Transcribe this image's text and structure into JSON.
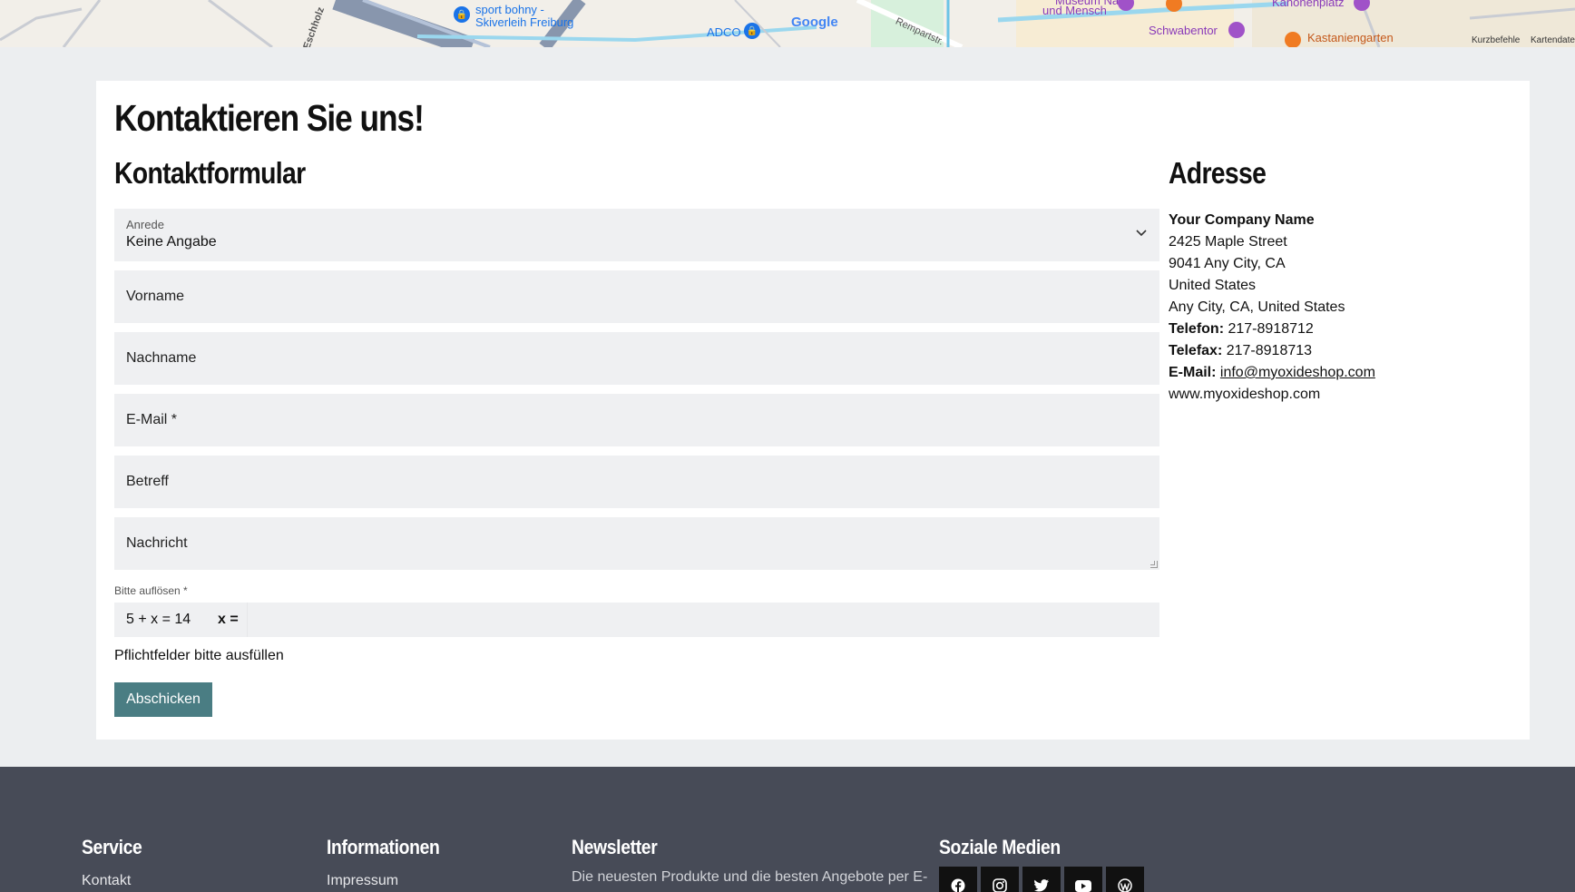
{
  "map": {
    "labels": {
      "sport": "sport bohny -",
      "skiverleih": "Skiverleih Freiburg",
      "adco": "ADCO",
      "google": "Google",
      "rempart": "Rempartstr.",
      "museum1": "Museum Natur",
      "museum2": "und Mensch",
      "schwabentor": "Schwabentor",
      "kanonenplatz": "Kanonenplatz",
      "kastaniengarten": "Kastaniengarten",
      "eschholz": "Eschholz",
      "shortcuts": "Kurzbefehle",
      "mapdata": "Kartendate"
    }
  },
  "page": {
    "title": "Kontaktieren Sie uns!"
  },
  "form": {
    "title": "Kontaktformular",
    "salutation_label": "Anrede",
    "salutation_value": "Keine Angabe",
    "first_name": "Vorname",
    "last_name": "Nachname",
    "email": "E-Mail *",
    "subject": "Betreff",
    "message": "Nachricht",
    "captcha_label": "Bitte auflösen *",
    "captcha_equation": "5 + x = 14",
    "captcha_x": "x =",
    "required_note": "Pflichtfelder bitte ausfüllen",
    "submit_label": "Abschicken"
  },
  "address": {
    "title": "Adresse",
    "company": "Your Company Name",
    "street": "2425 Maple Street",
    "city": "9041 Any City, CA",
    "country": "United States",
    "region": "Any City, CA, United States",
    "phone_label": "Telefon:",
    "phone": "217-8918712",
    "fax_label": "Telefax:",
    "fax": "217-8918713",
    "email_label": "E-Mail:",
    "email": "info@myoxideshop.com",
    "website": "www.myoxideshop.com"
  },
  "footer": {
    "service_title": "Service",
    "service_link": "Kontakt",
    "info_title": "Informationen",
    "info_link": "Impressum",
    "newsletter_title": "Newsletter",
    "newsletter_text": "Die neuesten Produkte und die besten Angebote per E-",
    "social_title": "Soziale Medien",
    "social_icons": [
      "facebook-icon",
      "instagram-icon",
      "twitter-icon",
      "youtube-icon",
      "wordpress-icon"
    ]
  },
  "colors": {
    "submit": "#4a7d83",
    "footer": "#474b57",
    "field": "#eff0f2",
    "page_bg": "#eceef0"
  }
}
